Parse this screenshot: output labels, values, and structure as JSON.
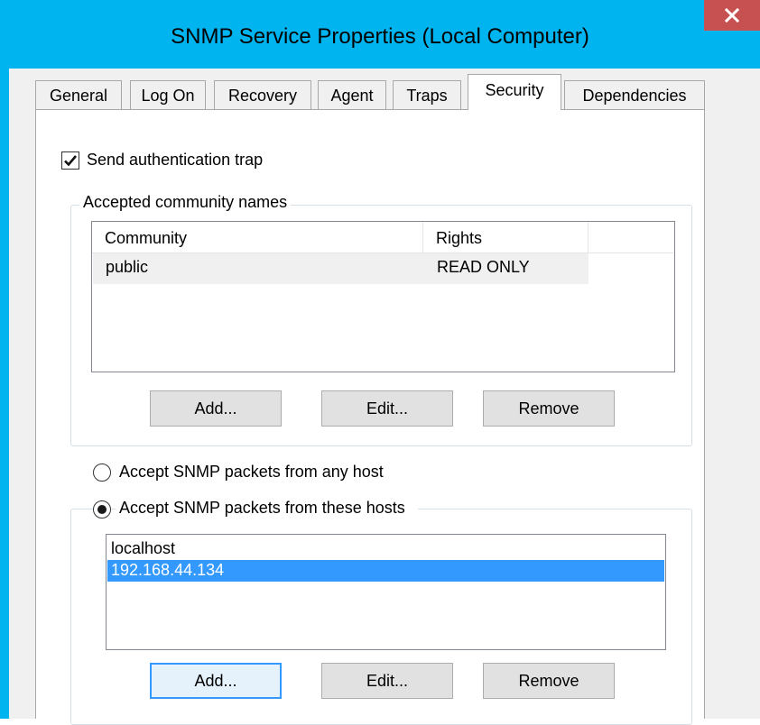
{
  "window": {
    "title": "SNMP Service Properties (Local Computer)",
    "close_label": "x",
    "accent_color": "#00b4f0",
    "close_color": "#c75050"
  },
  "tabs": [
    {
      "label": "General"
    },
    {
      "label": "Log On"
    },
    {
      "label": "Recovery"
    },
    {
      "label": "Agent"
    },
    {
      "label": "Traps"
    },
    {
      "label": "Security",
      "active": true
    },
    {
      "label": "Dependencies"
    }
  ],
  "security": {
    "send_auth_trap": {
      "label": "Send authentication trap",
      "checked": true
    },
    "communities": {
      "group_label": "Accepted community names",
      "columns": [
        "Community",
        "Rights"
      ],
      "rows": [
        {
          "community": "public",
          "rights": "READ ONLY"
        }
      ],
      "buttons": {
        "add": "Add...",
        "edit": "Edit...",
        "remove": "Remove"
      }
    },
    "hosts": {
      "any_host_label": "Accept SNMP packets from any host",
      "these_hosts_label": "Accept SNMP packets from these hosts",
      "selected_option": "these_hosts",
      "items": [
        "localhost",
        "192.168.44.134"
      ],
      "selected_item": "192.168.44.134",
      "buttons": {
        "add": "Add...",
        "edit": "Edit...",
        "remove": "Remove"
      }
    }
  }
}
